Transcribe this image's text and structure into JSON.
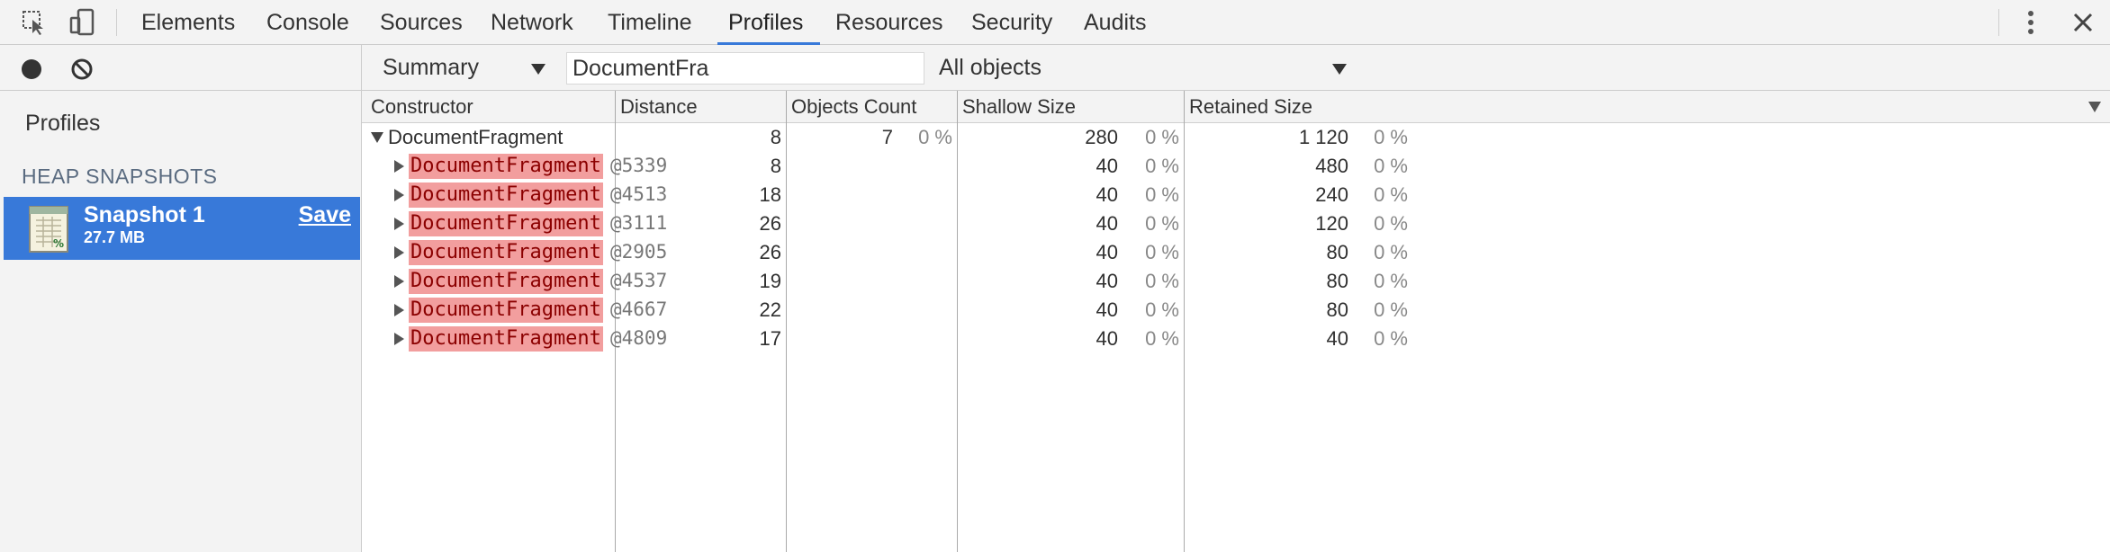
{
  "tabs": [
    "Elements",
    "Console",
    "Sources",
    "Network",
    "Timeline",
    "Profiles",
    "Resources",
    "Security",
    "Audits"
  ],
  "active_tab": "Profiles",
  "toolbar": {
    "view_select": "Summary",
    "class_filter": "DocumentFra",
    "objects_select": "All objects"
  },
  "sidebar": {
    "title": "Profiles",
    "section": "HEAP SNAPSHOTS",
    "snapshot": {
      "name": "Snapshot 1",
      "size": "27.7 MB",
      "save_label": "Save"
    }
  },
  "grid": {
    "columns": [
      "Constructor",
      "Distance",
      "Objects Count",
      "Shallow Size",
      "Retained Size"
    ],
    "group": {
      "name": "DocumentFragment",
      "distance": "8",
      "objects_count": "7",
      "objects_pct": "0 %",
      "shallow": "280",
      "shallow_pct": "0 %",
      "retained": "1 120",
      "retained_pct": "0 %"
    },
    "rows": [
      {
        "name": "DocumentFragment",
        "id": "@5339",
        "distance": "8",
        "shallow": "40",
        "shallow_pct": "0 %",
        "retained": "480",
        "retained_pct": "0 %"
      },
      {
        "name": "DocumentFragment",
        "id": "@4513",
        "distance": "18",
        "shallow": "40",
        "shallow_pct": "0 %",
        "retained": "240",
        "retained_pct": "0 %"
      },
      {
        "name": "DocumentFragment",
        "id": "@3111",
        "distance": "26",
        "shallow": "40",
        "shallow_pct": "0 %",
        "retained": "120",
        "retained_pct": "0 %"
      },
      {
        "name": "DocumentFragment",
        "id": "@2905",
        "distance": "26",
        "shallow": "40",
        "shallow_pct": "0 %",
        "retained": "80",
        "retained_pct": "0 %"
      },
      {
        "name": "DocumentFragment",
        "id": "@4537",
        "distance": "19",
        "shallow": "40",
        "shallow_pct": "0 %",
        "retained": "80",
        "retained_pct": "0 %"
      },
      {
        "name": "DocumentFragment",
        "id": "@4667",
        "distance": "22",
        "shallow": "40",
        "shallow_pct": "0 %",
        "retained": "80",
        "retained_pct": "0 %"
      },
      {
        "name": "DocumentFragment",
        "id": "@4809",
        "distance": "17",
        "shallow": "40",
        "shallow_pct": "0 %",
        "retained": "40",
        "retained_pct": "0 %"
      }
    ]
  },
  "colors": {
    "accent": "#3879d9",
    "highlight": "#f29e9e"
  }
}
